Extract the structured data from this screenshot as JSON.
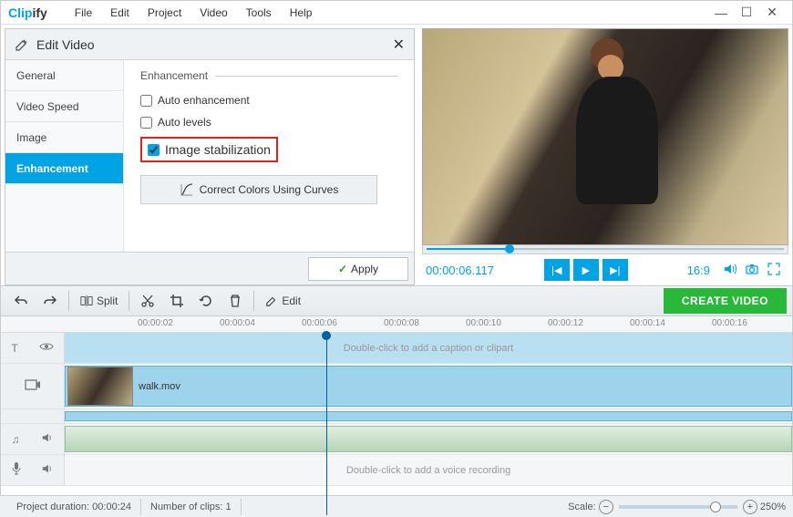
{
  "app": {
    "name_a": "Clip",
    "name_b": "ify"
  },
  "menu": [
    "File",
    "Edit",
    "Project",
    "Video",
    "Tools",
    "Help"
  ],
  "editPanel": {
    "title": "Edit Video",
    "tabs": [
      "General",
      "Video Speed",
      "Image",
      "Enhancement"
    ],
    "activeTab": 3,
    "section": "Enhancement",
    "opts": {
      "auto_enh": "Auto enhancement",
      "auto_lvl": "Auto levels",
      "stab": "Image stabilization"
    },
    "curvesBtn": "Correct Colors Using Curves",
    "apply": "Apply"
  },
  "preview": {
    "timecode": "00:00:06.117",
    "ratio": "16:9"
  },
  "toolbar": {
    "split": "Split",
    "edit": "Edit",
    "create": "CREATE VIDEO"
  },
  "ruler": [
    "00:00:02",
    "00:00:04",
    "00:00:06",
    "00:00:08",
    "00:00:10",
    "00:00:12",
    "00:00:14",
    "00:00:16"
  ],
  "timeline": {
    "captionHint": "Double-click to add a caption or clipart",
    "clipName": "walk.mov",
    "voiceHint": "Double-click to add a voice recording"
  },
  "status": {
    "projDurLabel": "Project duration:",
    "projDur": "00:00:24",
    "clipsLabel": "Number of clips:",
    "clips": "1",
    "scaleLabel": "Scale:",
    "scalePct": "250%"
  }
}
